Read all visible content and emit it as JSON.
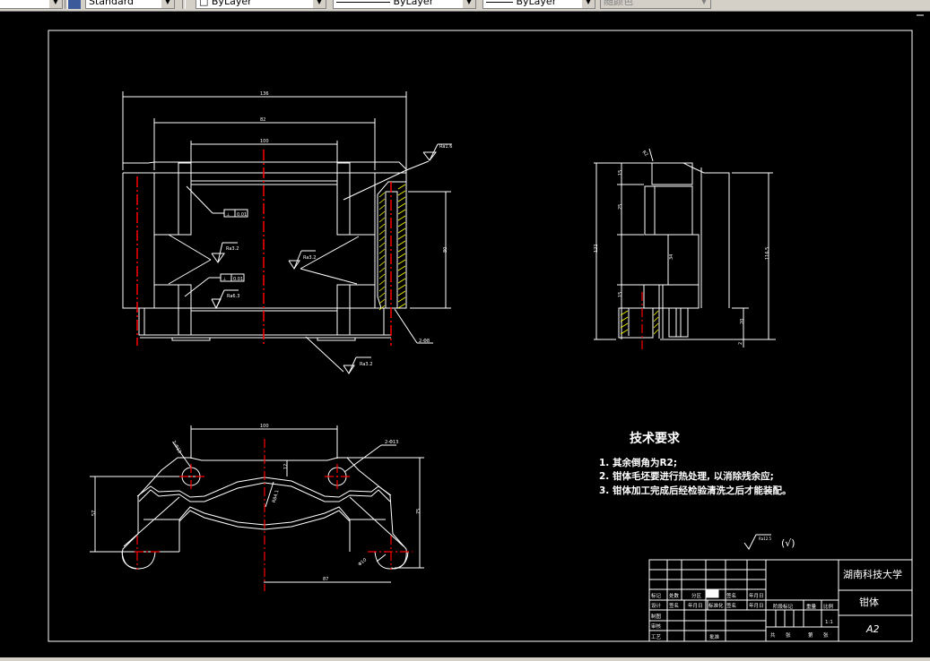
{
  "toolbar": {
    "text_style": "Standard",
    "layer": "ByLayer",
    "linetype": "ByLayer",
    "lineweight": "ByLayer",
    "plot_color": "随颜色"
  },
  "colors": {
    "background": "#000000",
    "lines": "#ffffff",
    "centerline": "#ff0000",
    "hatch": "#ffff00"
  },
  "front_view": {
    "dims": {
      "overall_width": "136",
      "mid_width": "82",
      "inner_width": "100",
      "height": "80",
      "holes": "2-Φ8"
    },
    "roughness": [
      "Ra1.6",
      "Ra3.2",
      "Ra6.3",
      "Ra3.2",
      "Ra3.2"
    ],
    "tolerance_frames": [
      {
        "sym": "⊥",
        "val": "0.01"
      },
      {
        "sym": "⊥",
        "val": "0.01"
      }
    ]
  },
  "side_view": {
    "dims": {
      "total": "122",
      "d1": "15",
      "d2": "25",
      "d3": "34",
      "d4": "15",
      "d5": "20",
      "d6": "116.5",
      "d7": "2",
      "radius": "R2"
    }
  },
  "top_view": {
    "dims": {
      "span": "100",
      "hole_top": "2-Φ13",
      "left_h": "57",
      "right_h": "75",
      "offset": "12",
      "radius": "R84.1",
      "bottom_hole": "Φ10",
      "bottom_span": "87"
    }
  },
  "tech_requirements": {
    "title": "技术要求",
    "items": [
      "1. 其余倒角为R2;",
      "2. 钳体毛坯要进行热处理, 以消除残余应;",
      "3. 钳体加工完成后经检验清洗之后才能装配。"
    ],
    "roughness_note": "Ra12.5",
    "roughness_other": "(√)"
  },
  "title_block": {
    "school": "湖南科技大学",
    "part_name": "钳体",
    "drawing_no": "A2",
    "scale_value": "1:1",
    "labels": {
      "mark": "标记",
      "count": "处数",
      "zone": "分区",
      "change_no": "更改文件号",
      "sign": "签名",
      "date": "年月日",
      "design": "设计",
      "std": "标准化",
      "drawing": "制图",
      "review": "审核",
      "process": "工艺",
      "approve": "批准",
      "stage": "阶段标记",
      "weight": "重量",
      "scale": "比例",
      "total": "共",
      "sheets": "张",
      "page": "第",
      "sheet": "张"
    }
  }
}
